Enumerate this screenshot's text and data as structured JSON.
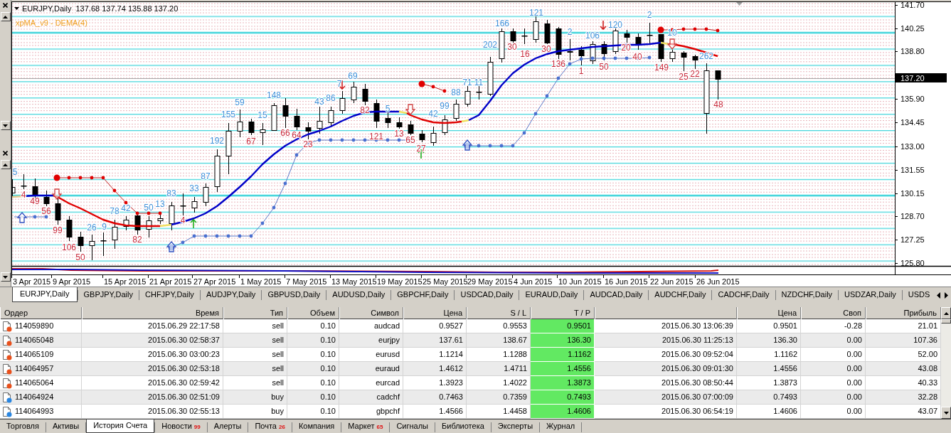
{
  "chart": {
    "title": "EURJPY,Daily",
    "ohlc": "137.68 137.74 135.88 137.20",
    "indicator": "xpMA_v9 - DEMA(4)",
    "price_ticks": [
      "141.70",
      "140.25",
      "138.80",
      "135.90",
      "134.45",
      "133.00",
      "131.55",
      "130.15",
      "128.70",
      "127.25",
      "125.80"
    ],
    "current_price": "137.20",
    "date_ticks": [
      "3 Apr 2015",
      "9 Apr 2015",
      "15 Apr 2015",
      "21 Apr 2015",
      "27 Apr 2015",
      "1 May 2015",
      "7 May 2015",
      "13 May 2015",
      "19 May 2015",
      "25 May 2015",
      "29 May 2015",
      "4 Jun 2015",
      "10 Jun 2015",
      "16 Jun 2015",
      "22 Jun 2015",
      "26 Jun 2015"
    ],
    "bar_labels": [
      {
        "text": "5",
        "color": "#3f8fd8"
      },
      {
        "text": "4",
        "color": "#c8283a"
      },
      {
        "text": "49",
        "color": "#c8283a"
      },
      {
        "text": "56",
        "color": "#c8283a"
      },
      {
        "text": "99",
        "color": "#c8283a"
      },
      {
        "text": "106",
        "color": "#c8283a"
      },
      {
        "text": "50",
        "color": "#c8283a"
      },
      {
        "text": "26",
        "color": "#3f8fd8"
      },
      {
        "text": "9",
        "color": "#3f8fd8"
      },
      {
        "text": "78",
        "color": "#3f8fd8"
      },
      {
        "text": "42",
        "color": "#3f8fd8"
      },
      {
        "text": "82",
        "color": "#c8283a"
      },
      {
        "text": "50",
        "color": "#3f8fd8"
      },
      {
        "text": "13",
        "color": "#3f8fd8"
      },
      {
        "text": "83",
        "color": "#3f8fd8"
      },
      {
        "text": "4",
        "color": "#c8283a"
      },
      {
        "text": "33",
        "color": "#3f8fd8"
      },
      {
        "text": "87",
        "color": "#3f8fd8"
      },
      {
        "text": "192",
        "color": "#3f8fd8"
      },
      {
        "text": "155",
        "color": "#3f8fd8"
      },
      {
        "text": "59",
        "color": "#3f8fd8"
      },
      {
        "text": "67",
        "color": "#c8283a"
      },
      {
        "text": "15",
        "color": "#3f8fd8"
      },
      {
        "text": "148",
        "color": "#3f8fd8"
      },
      {
        "text": "66",
        "color": "#c8283a"
      },
      {
        "text": "64",
        "color": "#c8283a"
      },
      {
        "text": "23",
        "color": "#c8283a"
      },
      {
        "text": "43",
        "color": "#3f8fd8"
      },
      {
        "text": "86",
        "color": "#3f8fd8"
      },
      {
        "text": "7",
        "color": "#3f8fd8"
      },
      {
        "text": "69",
        "color": "#3f8fd8"
      },
      {
        "text": "82",
        "color": "#c8283a"
      },
      {
        "text": "121",
        "color": "#c8283a"
      },
      {
        "text": "5",
        "color": "#3f8fd8"
      },
      {
        "text": "13",
        "color": "#c8283a"
      },
      {
        "text": "65",
        "color": "#c8283a"
      },
      {
        "text": "27",
        "color": "#c8283a"
      },
      {
        "text": "42",
        "color": "#3f8fd8"
      },
      {
        "text": "99",
        "color": "#3f8fd8"
      },
      {
        "text": "88",
        "color": "#3f8fd8"
      },
      {
        "text": "71",
        "color": "#3f8fd8"
      },
      {
        "text": "11",
        "color": "#3f8fd8"
      },
      {
        "text": "202",
        "color": "#3f8fd8"
      },
      {
        "text": "166",
        "color": "#3f8fd8"
      },
      {
        "text": "30",
        "color": "#c8283a"
      },
      {
        "text": "16",
        "color": "#c8283a"
      },
      {
        "text": "121",
        "color": "#3f8fd8"
      },
      {
        "text": "30",
        "color": "#c8283a"
      },
      {
        "text": "136",
        "color": "#c8283a"
      },
      {
        "text": "2",
        "color": "#3f8fd8"
      },
      {
        "text": "1",
        "color": "#c8283a"
      },
      {
        "text": "106",
        "color": "#3f8fd8"
      },
      {
        "text": "50",
        "color": "#c8283a"
      },
      {
        "text": "120",
        "color": "#3f8fd8"
      },
      {
        "text": "20",
        "color": "#c8283a"
      },
      {
        "text": "40",
        "color": "#c8283a"
      },
      {
        "text": "2",
        "color": "#3f8fd8"
      },
      {
        "text": "149",
        "color": "#c8283a"
      },
      {
        "text": "10",
        "color": "#3f8fd8"
      },
      {
        "text": "25",
        "color": "#c8283a"
      },
      {
        "text": "22",
        "color": "#c8283a"
      },
      {
        "text": "262",
        "color": "#3f8fd8"
      },
      {
        "text": "48",
        "color": "#c8283a"
      }
    ]
  },
  "chart_tabs": [
    {
      "label": "EURJPY,Daily",
      "selected": true
    },
    {
      "label": "GBPJPY,Daily",
      "selected": false
    },
    {
      "label": "CHFJPY,Daily",
      "selected": false
    },
    {
      "label": "AUDJPY,Daily",
      "selected": false
    },
    {
      "label": "GBPUSD,Daily",
      "selected": false
    },
    {
      "label": "AUDUSD,Daily",
      "selected": false
    },
    {
      "label": "GBPCHF,Daily",
      "selected": false
    },
    {
      "label": "USDCAD,Daily",
      "selected": false
    },
    {
      "label": "EURAUD,Daily",
      "selected": false
    },
    {
      "label": "AUDCAD,Daily",
      "selected": false
    },
    {
      "label": "AUDCHF,Daily",
      "selected": false
    },
    {
      "label": "CADCHF,Daily",
      "selected": false
    },
    {
      "label": "NZDCHF,Daily",
      "selected": false
    },
    {
      "label": "USDZAR,Daily",
      "selected": false
    },
    {
      "label": "USDS",
      "selected": false
    }
  ],
  "table": {
    "columns": {
      "order": "Ордер",
      "open_time": "Время",
      "type": "Тип",
      "volume": "Объем",
      "symbol": "Символ",
      "open_price": "Цена",
      "sl": "S / L",
      "tp": "T / P",
      "close_price": "Цена",
      "swap": "Своп",
      "profit": "Прибыль"
    },
    "rows": [
      {
        "kind": "sell",
        "tp_hit": true,
        "order": "114059890",
        "open_time": "2015.06.29 22:17:58",
        "type": "sell",
        "volume": "0.10",
        "symbol": "audcad",
        "open_price": "0.9527",
        "sl": "0.9553",
        "tp": "0.9501",
        "column_9": "2015.06.30 13:06:39",
        "close_price": "0.9501",
        "swap": "-0.28",
        "profit": "21.01"
      },
      {
        "kind": "sell",
        "tp_hit": true,
        "order": "114065048",
        "open_time": "2015.06.30 02:58:37",
        "type": "sell",
        "volume": "0.10",
        "symbol": "eurjpy",
        "open_price": "137.61",
        "sl": "138.67",
        "tp": "136.30",
        "column_9": "2015.06.30 11:25:13",
        "close_price": "136.30",
        "swap": "0.00",
        "profit": "107.36"
      },
      {
        "kind": "sell",
        "tp_hit": true,
        "order": "114065109",
        "open_time": "2015.06.30 03:00:23",
        "type": "sell",
        "volume": "0.10",
        "symbol": "eurusd",
        "open_price": "1.1214",
        "sl": "1.1288",
        "tp": "1.1162",
        "column_9": "2015.06.30 09:52:04",
        "close_price": "1.1162",
        "swap": "0.00",
        "profit": "52.00"
      },
      {
        "kind": "sell",
        "tp_hit": true,
        "order": "114064957",
        "open_time": "2015.06.30 02:53:18",
        "type": "sell",
        "volume": "0.10",
        "symbol": "euraud",
        "open_price": "1.4612",
        "sl": "1.4711",
        "tp": "1.4556",
        "column_9": "2015.06.30 09:01:30",
        "close_price": "1.4556",
        "swap": "0.00",
        "profit": "43.08"
      },
      {
        "kind": "sell",
        "tp_hit": true,
        "order": "114065064",
        "open_time": "2015.06.30 02:59:42",
        "type": "sell",
        "volume": "0.10",
        "symbol": "eurcad",
        "open_price": "1.3923",
        "sl": "1.4022",
        "tp": "1.3873",
        "column_9": "2015.06.30 08:50:44",
        "close_price": "1.3873",
        "swap": "0.00",
        "profit": "40.33"
      },
      {
        "kind": "buy",
        "tp_hit": true,
        "order": "114064924",
        "open_time": "2015.06.30 02:51:09",
        "type": "buy",
        "volume": "0.10",
        "symbol": "cadchf",
        "open_price": "0.7463",
        "sl": "0.7359",
        "tp": "0.7493",
        "column_9": "2015.06.30 07:00:09",
        "close_price": "0.7493",
        "swap": "0.00",
        "profit": "32.28"
      },
      {
        "kind": "buy",
        "tp_hit": true,
        "order": "114064993",
        "open_time": "2015.06.30 02:55:13",
        "type": "buy",
        "volume": "0.10",
        "symbol": "gbpchf",
        "open_price": "1.4566",
        "sl": "1.4458",
        "tp": "1.4606",
        "column_9": "2015.06.30 06:54:19",
        "close_price": "1.4606",
        "swap": "0.00",
        "profit": "43.07"
      }
    ]
  },
  "bottom_tabs": [
    {
      "label": "Торговля",
      "selected": false
    },
    {
      "label": "Активы",
      "selected": false
    },
    {
      "label": "История Счета",
      "selected": true
    },
    {
      "label": "Новости",
      "badge": "99",
      "selected": false
    },
    {
      "label": "Алерты",
      "selected": false
    },
    {
      "label": "Почта",
      "badge": "26",
      "selected": false
    },
    {
      "label": "Компания",
      "selected": false
    },
    {
      "label": "Маркет",
      "badge": "65",
      "selected": false
    },
    {
      "label": "Сигналы",
      "selected": false
    },
    {
      "label": "Библиотека",
      "selected": false
    },
    {
      "label": "Эксперты",
      "selected": false
    },
    {
      "label": "Журнал",
      "selected": false
    }
  ]
}
